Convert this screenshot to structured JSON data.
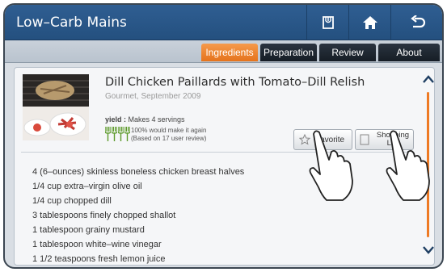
{
  "header": {
    "title": "Low–Carb Mains",
    "buttons": [
      {
        "name": "recipe-card-button",
        "icon": "recipe-card-icon"
      },
      {
        "name": "home-button",
        "icon": "home-icon"
      },
      {
        "name": "back-button",
        "icon": "back-arrow-icon"
      }
    ]
  },
  "tabs": [
    {
      "label": "Ingredients",
      "active": true
    },
    {
      "label": "Preparation",
      "active": false
    },
    {
      "label": "Review",
      "active": false
    },
    {
      "label": "About",
      "active": false
    }
  ],
  "recipe": {
    "title": "Dill Chicken Paillards with Tomato–Dill Relish",
    "source": "Gourmet, September 2009",
    "yield_label": "yield :",
    "yield_value": "Makes 4 servings",
    "rating_line1": "100% would make it again",
    "rating_line2": "(Based on 17 user review)",
    "fork_count": 4
  },
  "actions": {
    "favorite": "Favorite",
    "shopping": "Shopping List"
  },
  "ingredients": [
    "4 (6–ounces) skinless boneless chicken breast halves",
    "1/4 cup extra–virgin olive oil",
    "1/4 cup chopped dill",
    "3 tablespoons finely chopped shallot",
    "1 tablespoon grainy mustard",
    "1 tablespoon white–wine vinegar",
    "1 1/2 teaspoons fresh lemon juice"
  ],
  "colors": {
    "header": "#2a5688",
    "accent": "#ee7a24",
    "tab_dark": "#1c232c"
  }
}
